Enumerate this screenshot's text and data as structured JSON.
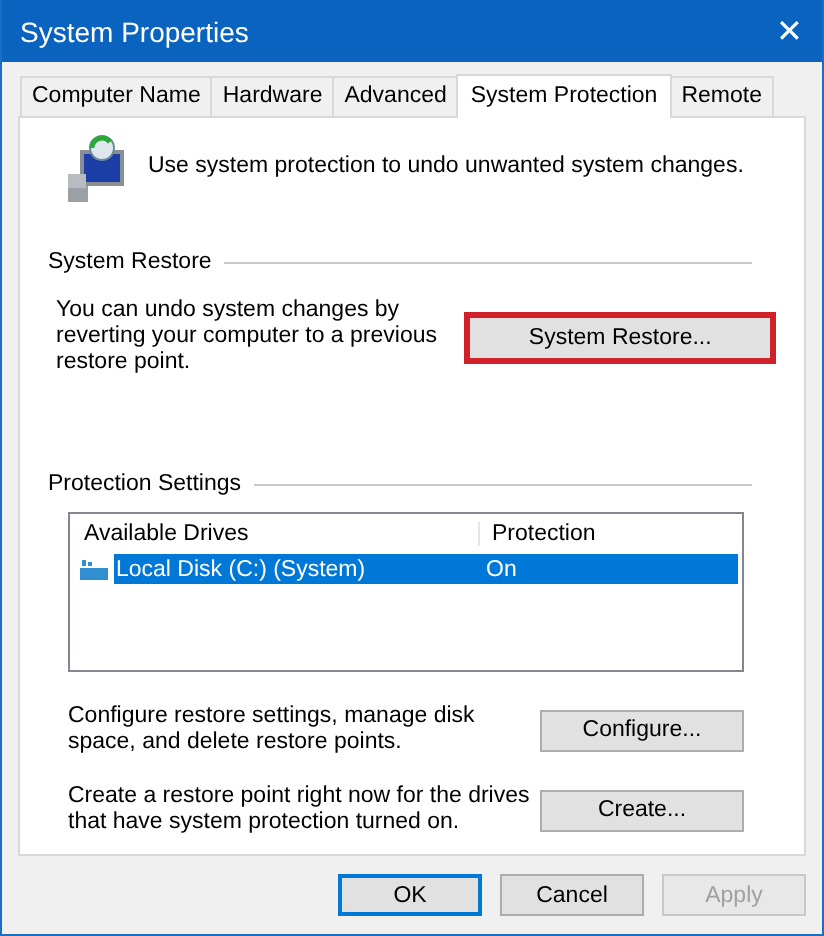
{
  "window": {
    "title": "System Properties",
    "close": "✕"
  },
  "tabs": [
    {
      "label": "Computer Name",
      "selected": false
    },
    {
      "label": "Hardware",
      "selected": false
    },
    {
      "label": "Advanced",
      "selected": false
    },
    {
      "label": "System Protection",
      "selected": true
    },
    {
      "label": "Remote",
      "selected": false
    }
  ],
  "intro": "Use system protection to undo unwanted system changes.",
  "system_restore": {
    "heading": "System Restore",
    "text": "You can undo system changes by reverting your computer to a previous restore point.",
    "button": {
      "label": "System Restore...",
      "highlighted": true
    }
  },
  "protection_settings": {
    "heading": "Protection Settings",
    "table": {
      "columns": [
        "Available Drives",
        "Protection"
      ],
      "rows": [
        {
          "drive": "Local Disk (C:) (System)",
          "protection": "On",
          "selected": true
        }
      ]
    },
    "actions": [
      {
        "text": "Configure restore settings, manage disk space, and delete restore points.",
        "button": {
          "label": "Configure...",
          "highlighted": false
        }
      },
      {
        "text": "Create a restore point right now for the drives that have system protection turned on.",
        "button": {
          "label": "Create...",
          "highlighted": false
        }
      }
    ]
  },
  "buttons": [
    {
      "label": "OK",
      "default": true,
      "disabled": false
    },
    {
      "label": "Cancel",
      "default": false,
      "disabled": false
    },
    {
      "label": "Apply",
      "default": false,
      "disabled": true
    }
  ]
}
